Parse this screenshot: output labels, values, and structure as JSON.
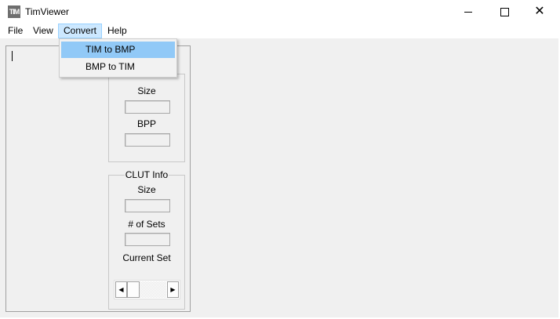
{
  "window": {
    "title": "TimViewer",
    "icon_text": "TIM",
    "controls": [
      "minimize",
      "maximize",
      "close"
    ]
  },
  "menubar": {
    "items": [
      {
        "label": "File"
      },
      {
        "label": "View"
      },
      {
        "label": "Convert",
        "active": true
      },
      {
        "label": "Help"
      }
    ]
  },
  "convert_menu": {
    "items": [
      {
        "label": "TIM to BMP",
        "highlighted": true
      },
      {
        "label": "BMP to TIM"
      }
    ]
  },
  "image_info": {
    "size_label": "Size",
    "size_value": "",
    "bpp_label": "BPP",
    "bpp_value": ""
  },
  "clut_info": {
    "title": "CLUT Info",
    "size_label": "Size",
    "size_value": "",
    "sets_label": "# of Sets",
    "sets_value": "",
    "current_set_label": "Current Set"
  },
  "icons": {
    "app": "tim-app-icon",
    "minimize": "minimize-icon",
    "maximize": "maximize-icon",
    "close": "close-icon",
    "scroll_left": "arrow-left-icon",
    "scroll_right": "arrow-right-icon"
  },
  "colors": {
    "menu_highlight": "#91c9f7",
    "menu_active": "#cce8ff",
    "background": "#f0f0f0"
  }
}
